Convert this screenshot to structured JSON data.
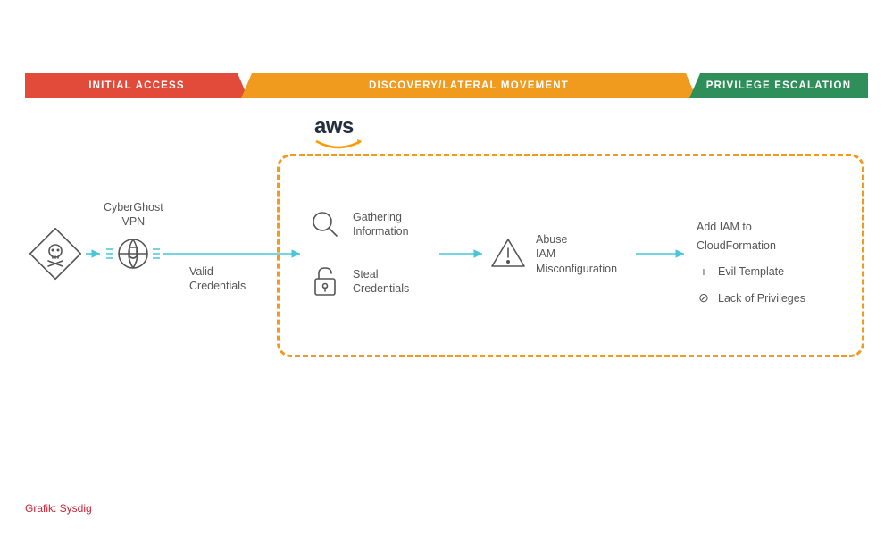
{
  "phases": {
    "p1": "INITIAL ACCESS",
    "p2": "DISCOVERY/LATERAL MOVEMENT",
    "p3": "PRIVILEGE ESCALATION"
  },
  "aws": "aws",
  "vpn": {
    "name": "CyberGhost",
    "sub": "VPN"
  },
  "valid_creds": {
    "l1": "Valid",
    "l2": "Credentials"
  },
  "gather": {
    "l1": "Gathering",
    "l2": "Information"
  },
  "steal": {
    "l1": "Steal",
    "l2": "Credentials"
  },
  "abuse": {
    "l1": "Abuse",
    "l2": "IAM",
    "l3": "Misconfiguration"
  },
  "escalation": {
    "title": {
      "l1": "Add IAM to",
      "l2": "CloudFormation"
    },
    "evil": "Evil Template",
    "lack": "Lack of Privileges"
  },
  "credit": "Grafik: Sysdig"
}
